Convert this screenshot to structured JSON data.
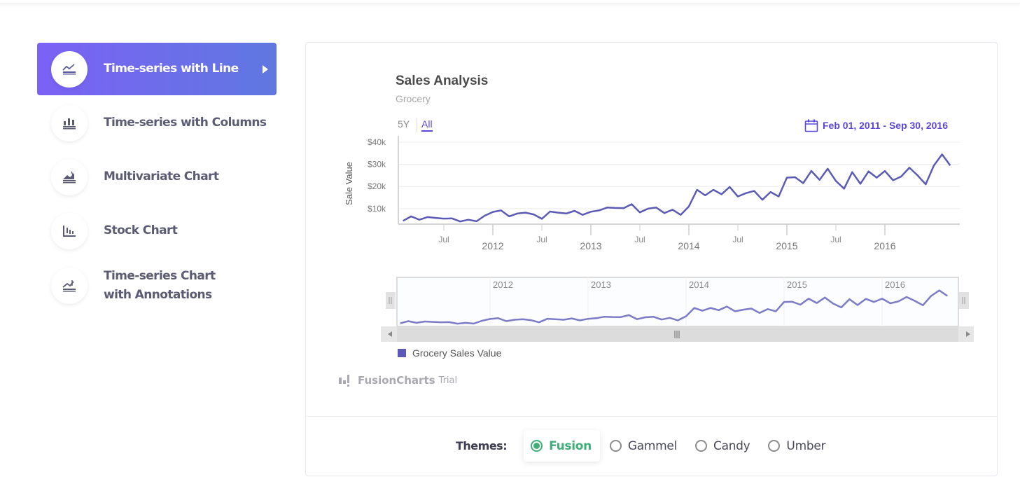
{
  "sidebar": {
    "items": [
      {
        "label": "Time-series with Line",
        "icon": "line-chart-icon",
        "active": true
      },
      {
        "label": "Time-series with Columns",
        "icon": "column-chart-icon",
        "active": false
      },
      {
        "label": "Multivariate Chart",
        "icon": "multivariate-chart-icon",
        "active": false
      },
      {
        "label": "Stock Chart",
        "icon": "stock-chart-icon",
        "active": false
      },
      {
        "label": "Time-series Chart with Annotations",
        "icon": "annotation-chart-icon",
        "active": false
      }
    ]
  },
  "chart": {
    "range_selector": {
      "options": [
        "5Y",
        "All"
      ],
      "selected": "All"
    },
    "date_range": "Feb 01, 2011 - Sep 30, 2016",
    "watermark": {
      "brand": "FusionCharts",
      "suffix": "Trial"
    }
  },
  "themes": {
    "label": "Themes:",
    "options": [
      "Fusion",
      "Gammel",
      "Candy",
      "Umber"
    ],
    "selected": "Fusion"
  },
  "colors": {
    "accent": "#5a48d8",
    "series": "#5b5bb5",
    "active_gradient_start": "#7b61f5",
    "active_gradient_end": "#5f78e0",
    "theme_selected": "#3fae78"
  },
  "chart_data": {
    "type": "line",
    "title": "Sales Analysis",
    "subtitle": "Grocery",
    "xlabel": "",
    "ylabel": "Sale Value",
    "y_ticks": [
      "$10k",
      "$20k",
      "$30k",
      "$40k"
    ],
    "y_tick_values": [
      10000,
      20000,
      30000,
      40000
    ],
    "ylim": [
      3000,
      40000
    ],
    "x_range": [
      "2011-02",
      "2016-09"
    ],
    "x_major_ticks": [
      "2012",
      "2013",
      "2014",
      "2015",
      "2016"
    ],
    "x_minor_ticks": [
      "Jul",
      "Jul",
      "Jul",
      "Jul",
      "Jul"
    ],
    "navigator_ticks": [
      "2012",
      "2013",
      "2014",
      "2015",
      "2016"
    ],
    "grid": true,
    "legend": {
      "position": "bottom-left",
      "entries": [
        "Grocery Sales Value"
      ]
    },
    "series": [
      {
        "name": "Grocery Sales Value",
        "x": [
          "2011-02",
          "2011-03",
          "2011-04",
          "2011-05",
          "2011-06",
          "2011-07",
          "2011-08",
          "2011-09",
          "2011-10",
          "2011-11",
          "2011-12",
          "2012-01",
          "2012-02",
          "2012-03",
          "2012-04",
          "2012-05",
          "2012-06",
          "2012-07",
          "2012-08",
          "2012-09",
          "2012-10",
          "2012-11",
          "2012-12",
          "2013-01",
          "2013-02",
          "2013-03",
          "2013-04",
          "2013-05",
          "2013-06",
          "2013-07",
          "2013-08",
          "2013-09",
          "2013-10",
          "2013-11",
          "2013-12",
          "2014-01",
          "2014-02",
          "2014-03",
          "2014-04",
          "2014-05",
          "2014-06",
          "2014-07",
          "2014-08",
          "2014-09",
          "2014-10",
          "2014-11",
          "2014-12",
          "2015-01",
          "2015-02",
          "2015-03",
          "2015-04",
          "2015-05",
          "2015-06",
          "2015-07",
          "2015-08",
          "2015-09",
          "2015-10",
          "2015-11",
          "2015-12",
          "2016-01",
          "2016-02",
          "2016-03",
          "2016-04",
          "2016-05",
          "2016-06",
          "2016-07",
          "2016-08",
          "2016-09"
        ],
        "values": [
          4500,
          6500,
          5000,
          6200,
          5800,
          5500,
          5600,
          4200,
          5000,
          4300,
          6800,
          8500,
          9200,
          6500,
          7800,
          8200,
          7400,
          5400,
          8700,
          8200,
          7800,
          9000,
          7200,
          8600,
          9200,
          10500,
          10300,
          10200,
          12000,
          8300,
          10000,
          10500,
          8000,
          9500,
          7200,
          11000,
          18500,
          16000,
          18500,
          16500,
          19800,
          15500,
          17000,
          18000,
          14000,
          17500,
          15500,
          24000,
          24200,
          21500,
          27000,
          23000,
          28000,
          22500,
          19000,
          26500,
          21200,
          26800,
          24000,
          27000,
          22800,
          24500,
          28500,
          25000,
          21000,
          29500,
          34500,
          29500
        ]
      }
    ]
  }
}
